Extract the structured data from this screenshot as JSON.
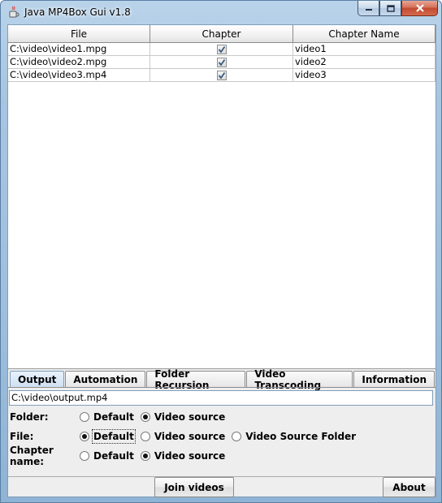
{
  "window": {
    "title": "Java MP4Box Gui v1.8"
  },
  "table": {
    "columns": [
      "File",
      "Chapter",
      "Chapter Name"
    ],
    "rows": [
      {
        "file": "C:\\video\\video1.mpg",
        "chapter": true,
        "chapter_name": "video1"
      },
      {
        "file": "C:\\video\\video2.mpg",
        "chapter": true,
        "chapter_name": "video2"
      },
      {
        "file": "C:\\video\\video3.mp4",
        "chapter": true,
        "chapter_name": "video3"
      }
    ]
  },
  "tabs": [
    "Output",
    "Automation",
    "Folder Recursion",
    "Video Transcoding",
    "Information"
  ],
  "active_tab": "Output",
  "output": {
    "path": "C:\\video\\output.mp4",
    "folder": {
      "label": "Folder:",
      "options": [
        "Default",
        "Video source"
      ],
      "selected": "Video source"
    },
    "file": {
      "label": "File:",
      "options": [
        "Default",
        "Video source",
        "Video Source Folder"
      ],
      "selected": "Default"
    },
    "chapter_name": {
      "label": "Chapter name:",
      "options": [
        "Default",
        "Video source"
      ],
      "selected": "Video source"
    }
  },
  "buttons": {
    "join": "Join videos",
    "about": "About"
  },
  "colors": {
    "frame": "#9fbfdc",
    "close_button": "#c24a30",
    "panel_bg": "#eeeeee"
  }
}
